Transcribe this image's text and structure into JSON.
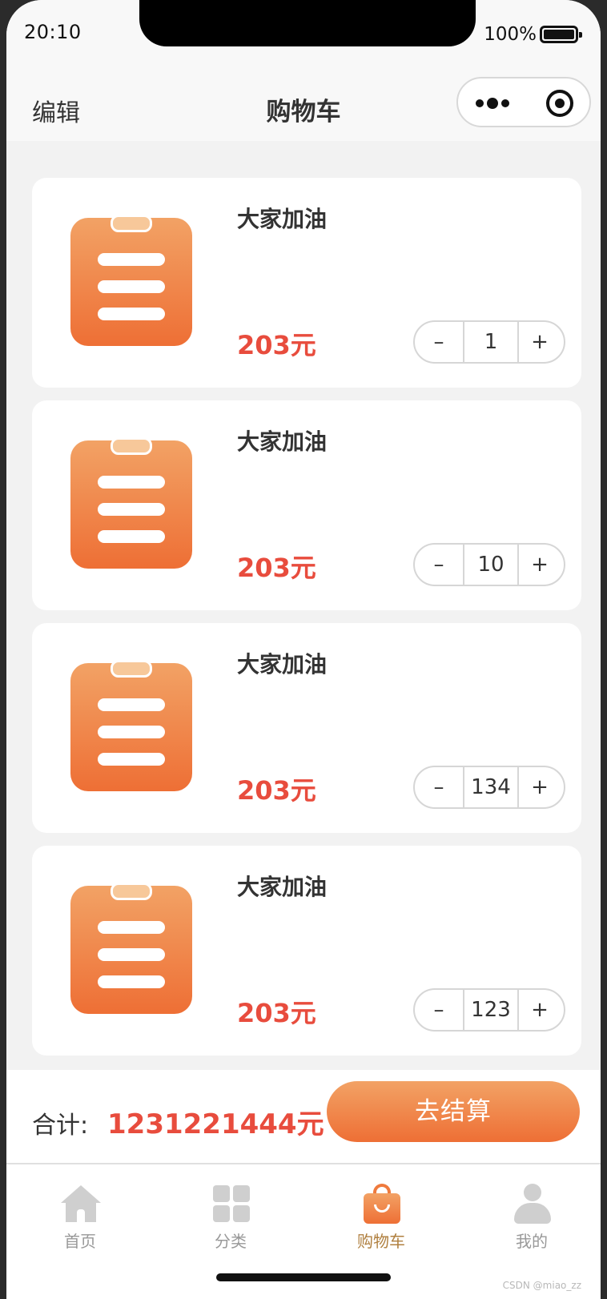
{
  "status_bar": {
    "time": "20:10",
    "battery": "100%"
  },
  "navbar": {
    "edit_label": "编辑",
    "title": "购物车"
  },
  "cart": {
    "items": [
      {
        "name": "大家加油",
        "price": "203元",
        "quantity": "1",
        "minus": "–",
        "plus": "+"
      },
      {
        "name": "大家加油",
        "price": "203元",
        "quantity": "10",
        "minus": "–",
        "plus": "+"
      },
      {
        "name": "大家加油",
        "price": "203元",
        "quantity": "134",
        "minus": "–",
        "plus": "+"
      },
      {
        "name": "大家加油",
        "price": "203元",
        "quantity": "123",
        "minus": "–",
        "plus": "+"
      }
    ]
  },
  "summary": {
    "total_label": "合计:",
    "total_value": "1231221444元",
    "checkout_label": "去结算"
  },
  "tabbar": {
    "tabs": [
      {
        "label": "首页",
        "icon": "home-icon",
        "active": false
      },
      {
        "label": "分类",
        "icon": "category-icon",
        "active": false
      },
      {
        "label": "购物车",
        "icon": "cart-bag-icon",
        "active": true
      },
      {
        "label": "我的",
        "icon": "profile-icon",
        "active": false
      }
    ]
  },
  "watermark": "CSDN @miao_zz",
  "colors": {
    "accent_orange": "#ee6f35",
    "price_red": "#e84c3d",
    "active_tab": "#b08040"
  }
}
